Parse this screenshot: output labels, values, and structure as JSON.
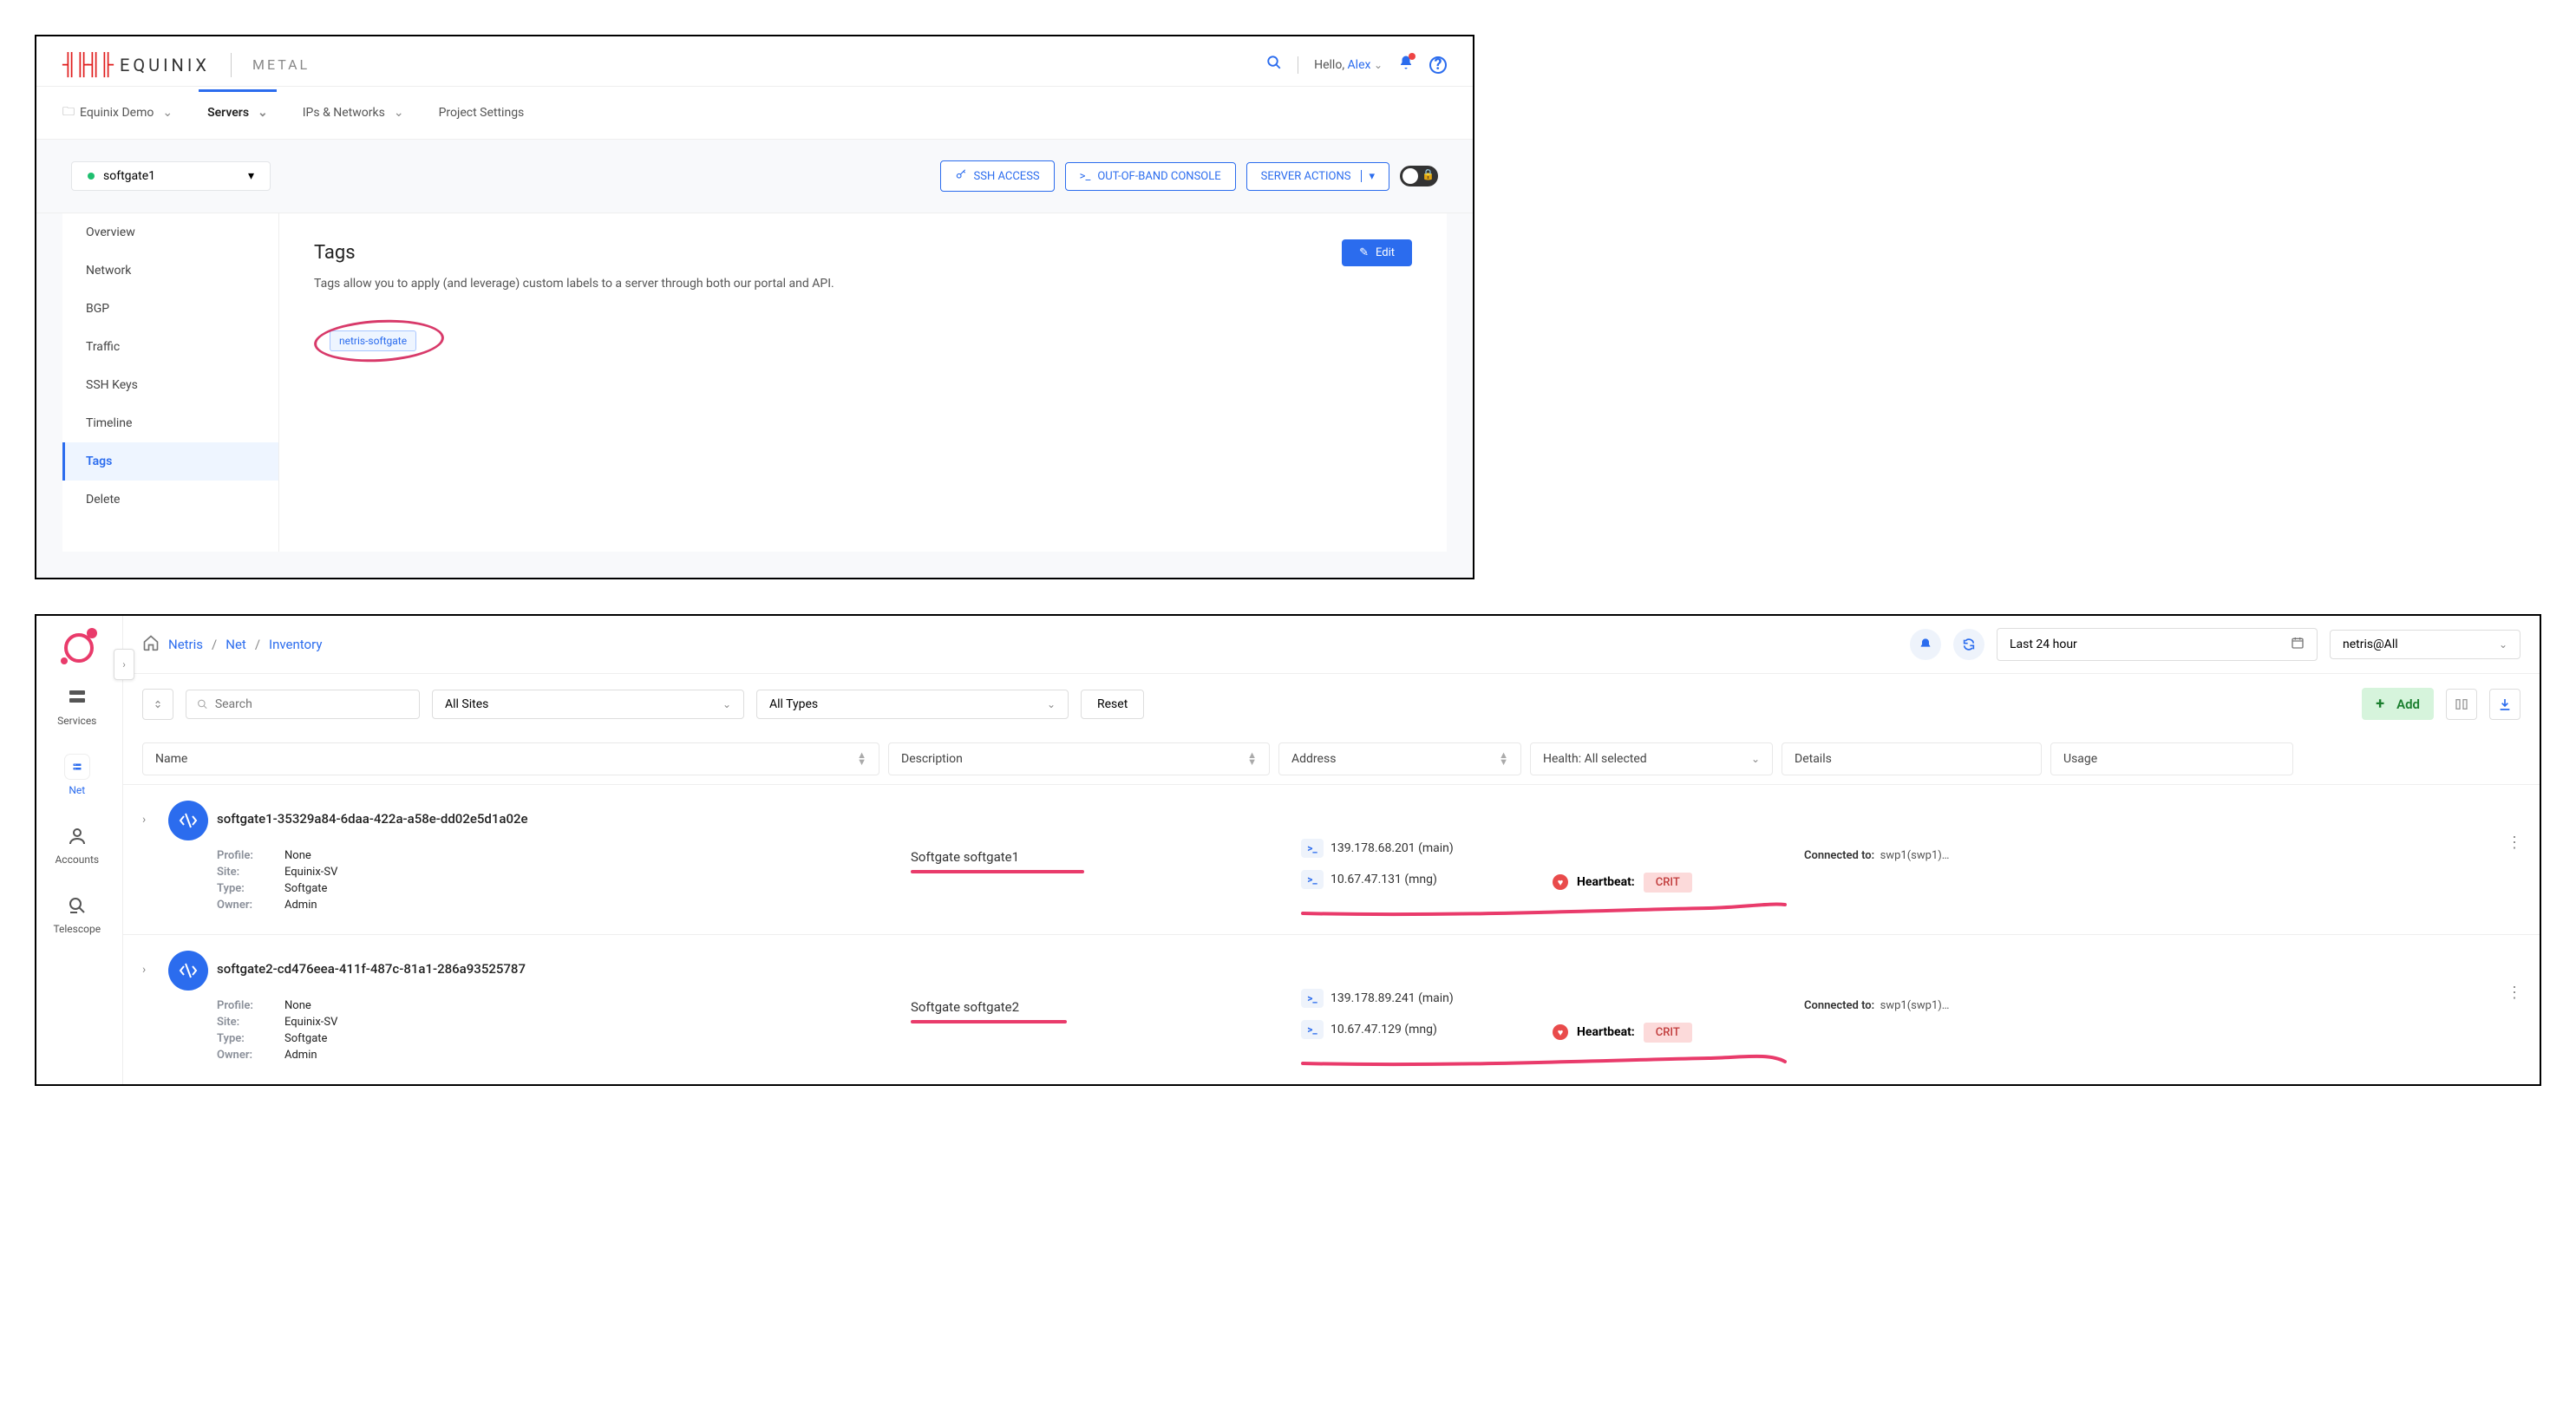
{
  "equinix": {
    "brand": "EQUINIX",
    "subbrand": "METAL",
    "greeting_prefix": "Hello, ",
    "greeting_name": "Alex",
    "nav": {
      "project": "Equinix Demo",
      "servers": "Servers",
      "ips": "IPs & Networks",
      "settings": "Project Settings"
    },
    "server_select": "softgate1",
    "toolbar": {
      "ssh": "SSH ACCESS",
      "oob": "OUT-OF-BAND CONSOLE",
      "actions": "SERVER ACTIONS"
    },
    "sidebar": [
      "Overview",
      "Network",
      "BGP",
      "Traffic",
      "SSH Keys",
      "Timeline",
      "Tags",
      "Delete"
    ],
    "sidebar_active_index": 6,
    "content": {
      "title": "Tags",
      "edit": "Edit",
      "desc": "Tags allow you to apply (and leverage) custom labels to a server through both our portal and API.",
      "tag": "netris-softgate"
    }
  },
  "netris": {
    "breadcrumbs": [
      "Netris",
      "Net",
      "Inventory"
    ],
    "timerange": "Last 24 hour",
    "tenant": "netris@All",
    "rail": [
      {
        "label": "Services",
        "icon": "srv"
      },
      {
        "label": "Net",
        "icon": "net"
      },
      {
        "label": "Accounts",
        "icon": "acc"
      },
      {
        "label": "Telescope",
        "icon": "tel"
      }
    ],
    "rail_active_index": 1,
    "filters": {
      "search_placeholder": "Search",
      "sites": "All Sites",
      "types": "All Types",
      "reset": "Reset",
      "add": "Add"
    },
    "columns": {
      "name": "Name",
      "desc": "Description",
      "addr": "Address",
      "health": "Health: All selected",
      "details": "Details",
      "usage": "Usage"
    },
    "rows": [
      {
        "name": "softgate1-35329a84-6daa-422a-a58e-dd02e5d1a02e",
        "profile": "None",
        "site": "Equinix-SV",
        "type": "Softgate",
        "owner": "Admin",
        "description": "Softgate softgate1",
        "addresses": [
          {
            "ip": "139.178.68.201",
            "suffix": "(main)"
          },
          {
            "ip": "10.67.47.131",
            "suffix": "(mng)"
          }
        ],
        "health_label": "Heartbeat:",
        "health_status": "CRIT",
        "connected_to_label": "Connected to:",
        "connected_to": "swp1(swp1)…"
      },
      {
        "name": "softgate2-cd476eea-411f-487c-81a1-286a93525787",
        "profile": "None",
        "site": "Equinix-SV",
        "type": "Softgate",
        "owner": "Admin",
        "description": "Softgate softgate2",
        "addresses": [
          {
            "ip": "139.178.89.241",
            "suffix": "(main)"
          },
          {
            "ip": "10.67.47.129",
            "suffix": "(mng)"
          }
        ],
        "health_label": "Heartbeat:",
        "health_status": "CRIT",
        "connected_to_label": "Connected to:",
        "connected_to": "swp1(swp1)…"
      }
    ],
    "meta_labels": {
      "profile": "Profile:",
      "site": "Site:",
      "type": "Type:",
      "owner": "Owner:"
    }
  }
}
